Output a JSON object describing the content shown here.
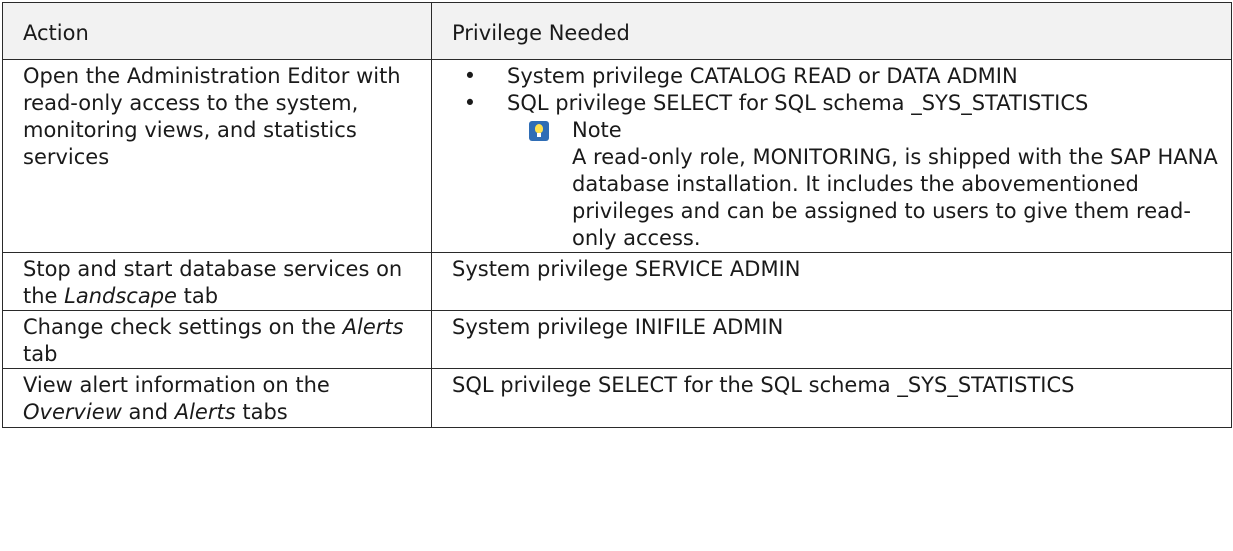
{
  "table": {
    "header": {
      "action": "Action",
      "privilege": "Privilege Needed"
    },
    "rows": [
      {
        "action": "Open the Administration Editor with read-only access to the system, monitoring views, and statistics services",
        "privileges": [
          "System privilege CATALOG READ or DATA ADMIN",
          "SQL privilege SELECT for SQL schema _SYS_STATISTICS"
        ],
        "note": {
          "icon": "note-icon",
          "title": "Note",
          "text": "A read-only role, MONITORING, is shipped with the SAP HANA database installation. It includes the abovementioned privileges and can be assigned to users to give them read-only access."
        }
      },
      {
        "action_pre": "Stop and start database services on the ",
        "action_em1": "Landscape",
        "action_post": " tab",
        "privilege": "System privilege SERVICE ADMIN"
      },
      {
        "action_pre": "Change check settings on the ",
        "action_em1": "Alerts",
        "action_post": " tab",
        "privilege": "System privilege INIFILE ADMIN"
      },
      {
        "action_pre": "View alert information on the ",
        "action_em1": "Overview",
        "action_mid": " and ",
        "action_em2": "Alerts",
        "action_post": " tabs",
        "privilege": "SQL privilege SELECT for the SQL schema _SYS_STATISTICS"
      }
    ]
  },
  "bullet_glyph": "•"
}
